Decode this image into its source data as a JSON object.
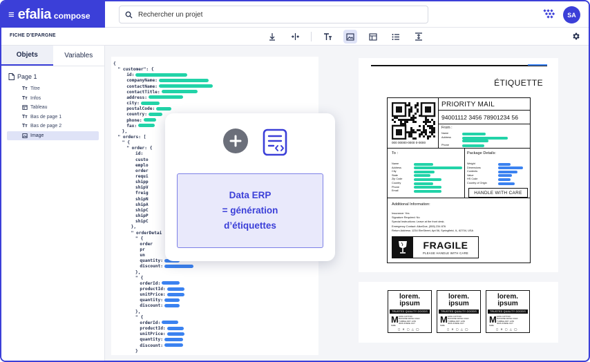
{
  "app": {
    "logo": "efalia",
    "product": "compose",
    "user_initials": "SA"
  },
  "search": {
    "placeholder": "Rechercher un projet"
  },
  "document": {
    "title": "FICHE D'EPARGNE"
  },
  "toolbar": {
    "icons": [
      "insert-row-icon",
      "split-columns-icon",
      "text-icon",
      "image-icon",
      "table-icon",
      "list-icon",
      "page-break-icon"
    ]
  },
  "left_panel": {
    "tabs": [
      {
        "label": "Objets",
        "active": true
      },
      {
        "label": "Variables",
        "active": false
      }
    ],
    "root": "Page 1",
    "items": [
      {
        "label": "Titre",
        "icon": "text-icon"
      },
      {
        "label": "Infos",
        "icon": "text-icon"
      },
      {
        "label": "Tableau",
        "icon": "table-icon"
      },
      {
        "label": "Bas de page 1",
        "icon": "text-icon"
      },
      {
        "label": "Bas de page 2",
        "icon": "text-icon"
      },
      {
        "label": "Image",
        "icon": "image-icon",
        "selected": true
      }
    ]
  },
  "code": {
    "lines": [
      {
        "text": "{",
        "indent": 0
      },
      {
        "text": "\" customer\": {",
        "indent": 1
      },
      {
        "text": "id:",
        "indent": 3,
        "bar": "g"
      },
      {
        "text": "companyName:",
        "indent": 3,
        "bar": "g"
      },
      {
        "text": "contactName:",
        "indent": 3,
        "bar": "g"
      },
      {
        "text": "contactTitle:",
        "indent": 3,
        "bar": "g"
      },
      {
        "text": "address:",
        "indent": 3,
        "bar": "g"
      },
      {
        "text": "city:",
        "indent": 3,
        "bar": "g"
      },
      {
        "text": "postalCode:",
        "indent": 3,
        "bar": "g"
      },
      {
        "text": "country:",
        "indent": 3,
        "bar": "g"
      },
      {
        "text": "phone:",
        "indent": 3,
        "bar": "g"
      },
      {
        "text": "fax:",
        "indent": 3,
        "bar": "g"
      },
      {
        "text": "},",
        "indent": 2
      },
      {
        "text": "\" orders: [",
        "indent": 1
      },
      {
        "text": "\" {",
        "indent": 2
      },
      {
        "text": "\" order: {",
        "indent": 3
      },
      {
        "text": "id:",
        "indent": 5
      },
      {
        "text": "custo",
        "indent": 5
      },
      {
        "text": "emplo",
        "indent": 5
      },
      {
        "text": "order",
        "indent": 5
      },
      {
        "text": "requi",
        "indent": 5
      },
      {
        "text": "shipp",
        "indent": 5
      },
      {
        "text": "shipV",
        "indent": 5
      },
      {
        "text": "freig",
        "indent": 5
      },
      {
        "text": "shipN",
        "indent": 5
      },
      {
        "text": "shipA",
        "indent": 5
      },
      {
        "text": "shipC",
        "indent": 5
      },
      {
        "text": "shipP",
        "indent": 5
      },
      {
        "text": "shipC",
        "indent": 5
      },
      {
        "text": "},",
        "indent": 4
      },
      {
        "text": "\" orderDetai",
        "indent": 4
      },
      {
        "text": "\" {",
        "indent": 5
      },
      {
        "text": "order",
        "indent": 6
      },
      {
        "text": "pr",
        "indent": 6
      },
      {
        "text": "un",
        "indent": 6
      },
      {
        "text": "quantity:",
        "indent": 6,
        "bar": "b"
      },
      {
        "text": "discount:",
        "indent": 6,
        "bar": "b"
      },
      {
        "text": "},",
        "indent": 5
      },
      {
        "text": "\" {",
        "indent": 5
      },
      {
        "text": "orderId:",
        "indent": 6,
        "bar": "b"
      },
      {
        "text": "productId:",
        "indent": 6,
        "bar": "b"
      },
      {
        "text": "unitPrice:",
        "indent": 6,
        "bar": "b"
      },
      {
        "text": "quantity:",
        "indent": 6,
        "bar": "b"
      },
      {
        "text": "discount:",
        "indent": 6,
        "bar": "b"
      },
      {
        "text": "},",
        "indent": 5
      },
      {
        "text": "\" {",
        "indent": 5
      },
      {
        "text": "orderId:",
        "indent": 6,
        "bar": "b"
      },
      {
        "text": "productId:",
        "indent": 6,
        "bar": "b"
      },
      {
        "text": "unitPrice:",
        "indent": 6,
        "bar": "b"
      },
      {
        "text": "quantity:",
        "indent": 6,
        "bar": "b"
      },
      {
        "text": "discount:",
        "indent": 6,
        "bar": "b"
      },
      {
        "text": "}",
        "indent": 5
      }
    ]
  },
  "overlay": {
    "line1": "Data ERP",
    "line2": "= génération",
    "line3": "d’étiquettes"
  },
  "label": {
    "heading": "ÉTIQUETTE",
    "service": "PRIORITY MAIL",
    "tracking": "94001112 3456 78901234 56",
    "barcode_number": "000 00000-0000 0-0000",
    "from_title": "From :",
    "from_fields": [
      "Name",
      "Address",
      "Phone"
    ],
    "to_title": "To :",
    "to_fields": [
      "Name",
      "Address",
      "City",
      "State",
      "Zip Code",
      "Country",
      "Phone",
      "Email"
    ],
    "package_title": "Package Details:",
    "package_fields": [
      "Weight",
      "Dimensions",
      "Contents",
      "Value",
      "HS Code",
      "Country of Origin"
    ],
    "handle": "HANDLE WITH CARE",
    "additional_title": "Additional Information:",
    "additional_lines": [
      "Insurance: Yes",
      "Signature Required: No",
      "Special Instructions: Leave at the front desk.",
      "Emergency Contact: AliceDoe, (555) 234 876",
      "Return Address: 1234 ElmStreet, Apt 56, Springfield, IL, 62704, USA"
    ],
    "fragile": "FRAGILE",
    "fragile_sub": "PLEASE HANDLE WITH CARE"
  },
  "tags": [
    {
      "title": "lorem.\nipsum",
      "quality": "TRUSTED QUALITY GOODS",
      "size": "M"
    },
    {
      "title": "lorem.\nipsum",
      "quality": "TRUSTED QUALITY GOODS",
      "size": "M"
    },
    {
      "title": "lorem.\nipsum",
      "quality": "TRUSTED QUALITY GOODS",
      "size": "M"
    }
  ],
  "tag_info": "100% COTTON\nMACHINE WASH COLD\nTUMBLE DRY LOW\nIRON INSIDE OUT",
  "tag_size_caption": "SIZE",
  "tag_symbols": "◻ ✕ ▢ △ ◯",
  "colors": {
    "accent": "#3b3fd8",
    "green_bar": "#22d3a8",
    "blue_bar": "#3b82f0"
  }
}
